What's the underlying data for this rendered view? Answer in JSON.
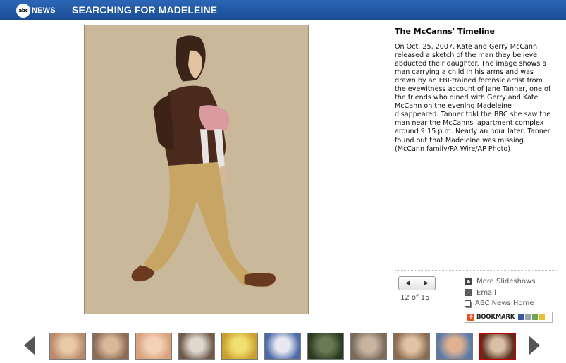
{
  "header": {
    "logo_ball": "abc",
    "logo_text": "NEWS",
    "title": "SEARCHING FOR MADELEINE",
    "bar_color": "#1f559f"
  },
  "photo": {
    "description_alt": "Sketch of a man carrying a child"
  },
  "caption": {
    "title": "The McCanns' Timeline",
    "body": "On Oct. 25, 2007, Kate and Gerry McCann released a sketch of the man they believe abducted their daughter. The image shows a man carrying a child in his arms and was drawn by an FBI-trained forensic artist from the eyewitness account of Jane Tanner, one of the friends who dined with Gerry and Kate McCann on the evening Madeleine disappeared. Tanner told the BBC she saw the man near the McCanns' apartment complex around 9:15 p.m. Nearly an hour later, Tanner found out that Madeleine was missing.",
    "credit": "(McCann family/PA Wire/AP Photo)"
  },
  "navigation": {
    "prev_glyph": "◀",
    "next_glyph": "▶",
    "counter": "12 of 15",
    "current": 12,
    "total": 15
  },
  "links": [
    {
      "label": "More Slideshows",
      "icon": "camera-icon"
    },
    {
      "label": "Email",
      "icon": "envelope-icon"
    },
    {
      "label": "ABC News Home",
      "icon": "pages-icon"
    }
  ],
  "bookmark": {
    "label": "BOOKMARK",
    "plus": "+",
    "accent": "#e8501a"
  },
  "thumbnails": {
    "count": 11,
    "active_index": 10,
    "active_border": "#c00000",
    "colors": [
      [
        "#b98a6a",
        "#e8c9a8"
      ],
      [
        "#8c6a55",
        "#d9b89a"
      ],
      [
        "#d9a07a",
        "#f3d2b8"
      ],
      [
        "#6f5a4a",
        "#ded8cf"
      ],
      [
        "#c9a030",
        "#f0e070"
      ],
      [
        "#4a6aa8",
        "#e8e8f0"
      ],
      [
        "#2a3a20",
        "#6a7a55"
      ],
      [
        "#7a6a5a",
        "#c9b4a0"
      ],
      [
        "#8a6a50",
        "#e0c2a5"
      ],
      [
        "#5a7aa8",
        "#e0b090"
      ],
      [
        "#5a3020",
        "#d8bfa5"
      ]
    ]
  }
}
